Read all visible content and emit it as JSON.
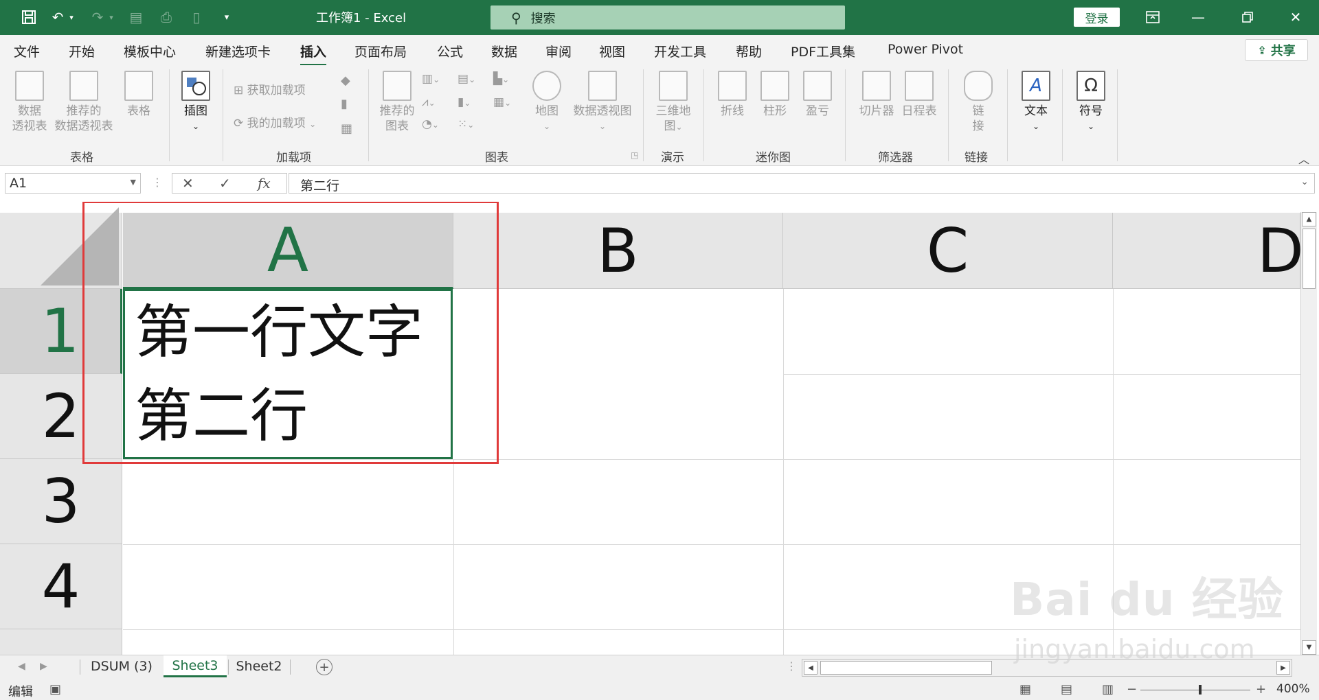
{
  "titlebar": {
    "title": "工作簿1  -  Excel",
    "search_placeholder": "搜索",
    "login_label": "登录"
  },
  "menu": {
    "tabs": [
      "文件",
      "开始",
      "模板中心",
      "新建选项卡",
      "插入",
      "页面布局",
      "公式",
      "数据",
      "审阅",
      "视图",
      "开发工具",
      "帮助",
      "PDF工具集",
      "Power Pivot"
    ],
    "active": "插入",
    "share_label": "共享"
  },
  "ribbon": {
    "pivot_table": [
      "数据",
      "透视表"
    ],
    "recommended_pivot": [
      "推荐的",
      "数据透视表"
    ],
    "table": "表格",
    "picture": "插图",
    "get_addins": "获取加载项",
    "my_addins": "我的加载项",
    "recommended_charts": [
      "推荐的",
      "图表"
    ],
    "map": "地图",
    "pivot_chart": "数据透视图",
    "map_3d": [
      "三维地",
      "图"
    ],
    "line": "折线",
    "column": "柱形",
    "win_loss": "盈亏",
    "slicer": "切片器",
    "timeline": "日程表",
    "link": [
      "链",
      "接"
    ],
    "text": "文本",
    "symbol": "符号",
    "groups": {
      "tables": "表格",
      "addins": "加载项",
      "charts": "图表",
      "tours": "演示",
      "sparklines": "迷你图",
      "filters": "筛选器",
      "links": "链接"
    }
  },
  "formula_bar": {
    "name_box": "A1",
    "cancel": "✕",
    "enter": "✓",
    "fx": "fx",
    "content": "第二行"
  },
  "grid": {
    "columns": [
      "A",
      "B",
      "C",
      "D"
    ],
    "rows": [
      "1",
      "2",
      "3",
      "4"
    ],
    "selected_cell": "A1",
    "a1_lines": [
      "第一行文字",
      "第二行"
    ]
  },
  "sheets": {
    "tabs": [
      "DSUM (3)",
      "Sheet3",
      "Sheet2"
    ],
    "active": "Sheet3"
  },
  "status": {
    "mode": "编辑",
    "zoom": "400%"
  },
  "watermark": {
    "brand": "Bai du 经验",
    "url": "jingyan.baidu.com"
  },
  "colors": {
    "excel_green": "#217346",
    "annotation_red": "#e03a3a"
  }
}
